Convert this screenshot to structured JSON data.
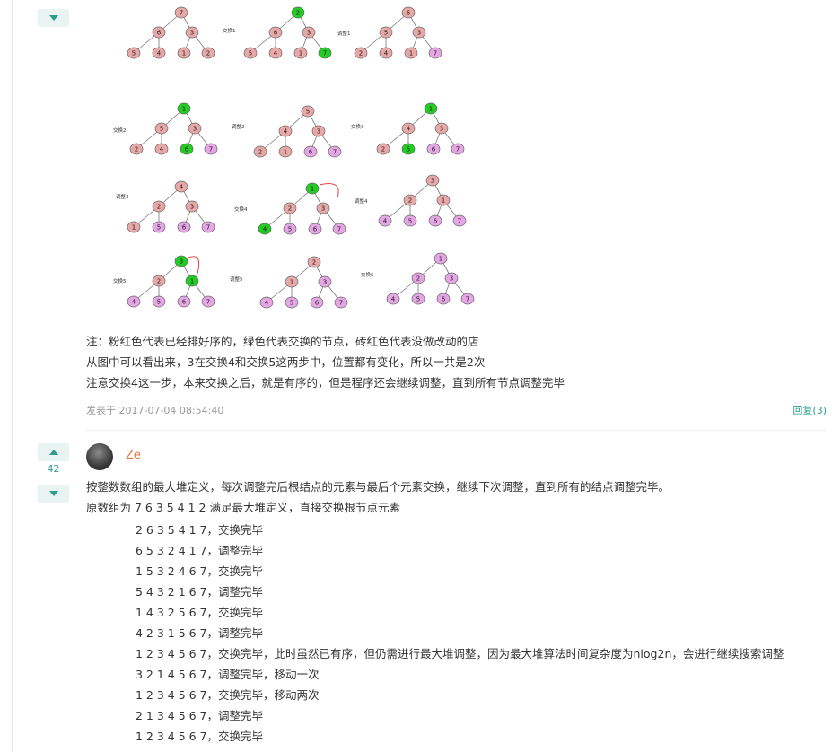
{
  "figure": {
    "labels": {
      "swap1": "交换1",
      "adjust1": "调整1",
      "swap2": "交换2",
      "adjust2": "调整2",
      "swap3": "交换3",
      "adjust3": "调整3",
      "swap4": "交换4",
      "adjust4": "调整4",
      "swap5": "交换5",
      "adjust5": "调整5",
      "swap6": "交换6"
    },
    "colors": {
      "sorted": "#e6a6e6",
      "swapped": "#22cc22",
      "unchanged": "#e8a8a8"
    }
  },
  "first_comment": {
    "lines": [
      "注：粉红色代表已经排好序的，绿色代表交换的节点，砖红色代表没做改动的店",
      "从图中可以看出来，3在交换4和交换5这两步中，位置都有变化，所以一共是2次",
      "注意交换4这一步，本来交换之后，就是有序的，但是程序还会继续调整，直到所有节点调整完毕"
    ],
    "posted": "发表于 2017-07-04 08:54:40",
    "reply": "回复(3)"
  },
  "second_comment": {
    "vote_count": "42",
    "username": "Ze",
    "intro": [
      "按整数数组的最大堆定义，每次调整完后根结点的元素与最后个元素交换，继续下次调整，直到所有的结点调整完毕。",
      "原数组为 7 6 3 5 4 1 2 满足最大堆定义，直接交换根节点元素"
    ],
    "steps": [
      "2 6 3 5 4 1 7，交换完毕",
      "6 5 3 2 4 1 7，调整完毕",
      "1 5 3 2 4 6 7，交换完毕",
      "5 4 3 2 1 6 7，调整完毕",
      "1 4 3 2 5 6 7，交换完毕",
      "4 2 3 1 5 6 7，调整完毕",
      "1 2 3 4 5 6 7，交换完毕，此时虽然已有序，但仍需进行最大堆调整，因为最大堆算法时间复杂度为nlog2n，会进行继续搜索调整",
      "3 2 1 4 5 6 7，调整完毕，移动一次",
      "1 2 3 4 5 6 7，交换完毕，移动两次",
      "2 1 3 4 5 6 7，调整完毕",
      "1 2 3 4 5 6 7，交换完毕"
    ]
  }
}
